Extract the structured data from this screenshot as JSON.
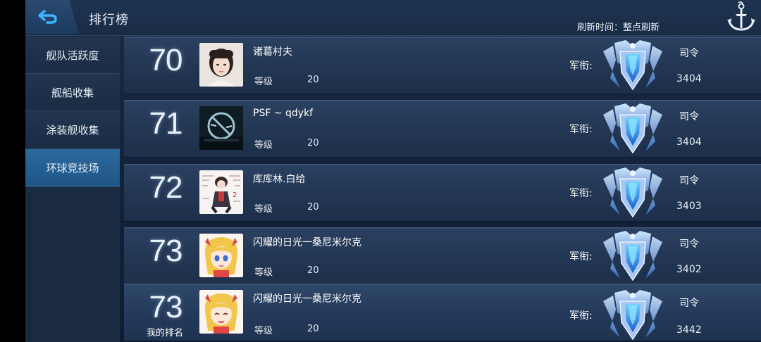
{
  "header": {
    "title": "排行榜",
    "refresh_text": "刷新时间：整点刷新"
  },
  "sidebar": {
    "items": [
      {
        "label": "舰队活跃度",
        "active": false
      },
      {
        "label": "舰船收集",
        "active": false
      },
      {
        "label": "涂装舰收集",
        "active": false
      },
      {
        "label": "环球竞技场",
        "active": true
      }
    ]
  },
  "rows": [
    {
      "rank": "70",
      "name": "诸葛村夫",
      "level_label": "等级",
      "level": "20",
      "rank_label": "军衔:",
      "rank_title": "司令",
      "score": "3404"
    },
    {
      "rank": "71",
      "name": "PSF ~ qdykf",
      "level_label": "等级",
      "level": "20",
      "rank_label": "军衔:",
      "rank_title": "司令",
      "score": "3404"
    },
    {
      "rank": "72",
      "name": "库库林.白给",
      "level_label": "等级",
      "level": "20",
      "rank_label": "军衔:",
      "rank_title": "司令",
      "score": "3403"
    },
    {
      "rank": "73",
      "name": "闪耀的日光一桑尼米尔克",
      "level_label": "等级",
      "level": "20",
      "rank_label": "军衔:",
      "rank_title": "司令",
      "score": "3402"
    },
    {
      "rank": "73",
      "name": "闪耀的日光一桑尼米尔克",
      "level_label": "等级",
      "level": "20",
      "rank_label": "军衔:",
      "rank_title": "司令",
      "score": "3442",
      "my_rank_label": "我的排名"
    }
  ]
}
